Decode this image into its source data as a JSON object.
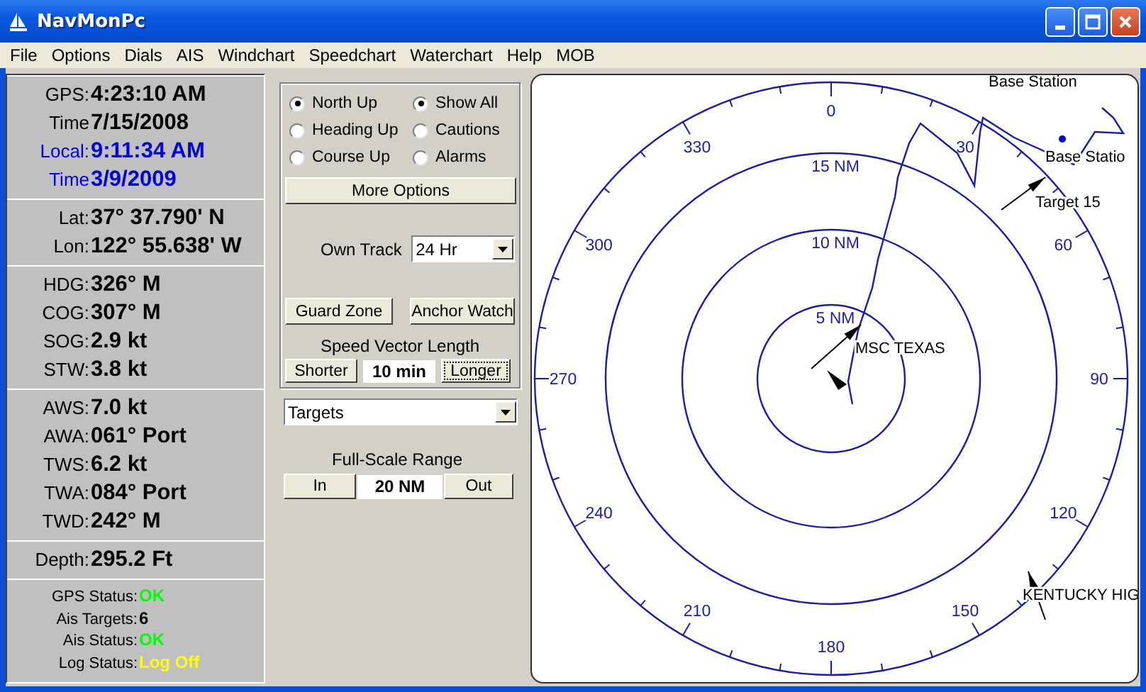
{
  "window": {
    "title": "NavMonPc"
  },
  "menu": [
    "File",
    "Options",
    "Dials",
    "AIS",
    "Windchart",
    "Speedchart",
    "Waterchart",
    "Help",
    "MOB"
  ],
  "nav_panel": {
    "groups": [
      {
        "kind": "large",
        "rows": [
          {
            "label": "GPS:",
            "value": "4:23:10 AM",
            "local": false
          },
          {
            "label": "Time",
            "value": "7/15/2008",
            "local": false
          },
          {
            "label": "Local:",
            "value": "9:11:34 AM",
            "local": true
          },
          {
            "label": "Time",
            "value": "3/9/2009",
            "local": true
          }
        ]
      },
      {
        "kind": "large",
        "rows": [
          {
            "label": "Lat:",
            "value": "37° 37.790' N",
            "local": false
          },
          {
            "label": "Lon:",
            "value": "122° 55.638' W",
            "local": false
          }
        ]
      },
      {
        "kind": "large",
        "rows": [
          {
            "label": "HDG:",
            "value": "326° M",
            "local": false
          },
          {
            "label": "COG:",
            "value": "307° M",
            "local": false
          },
          {
            "label": "SOG:",
            "value": "2.9 kt",
            "local": false
          },
          {
            "label": "STW:",
            "value": "3.8 kt",
            "local": false
          }
        ]
      },
      {
        "kind": "large",
        "rows": [
          {
            "label": "AWS:",
            "value": "7.0 kt",
            "local": false
          },
          {
            "label": "AWA:",
            "value": "061° Port",
            "local": false
          },
          {
            "label": "TWS:",
            "value": "6.2 kt",
            "local": false
          },
          {
            "label": "TWA:",
            "value": "084° Port",
            "local": false
          },
          {
            "label": "TWD:",
            "value": "242° M",
            "local": false
          }
        ]
      },
      {
        "kind": "large",
        "rows": [
          {
            "label": "Depth:",
            "value": "295.2 Ft",
            "local": false
          }
        ]
      },
      {
        "kind": "status",
        "rows": [
          {
            "label": "GPS Status:",
            "value": "OK",
            "color": "#00ff00"
          },
          {
            "label": "Ais Targets:",
            "value": "6",
            "color": "#000000"
          },
          {
            "label": "Ais Status:",
            "value": "OK",
            "color": "#00ff00"
          },
          {
            "label": "Log Status:",
            "value": "Log Off",
            "color": "#ffff00"
          }
        ]
      }
    ]
  },
  "display_controls": {
    "orientation": [
      {
        "label": "North Up",
        "selected": true
      },
      {
        "label": "Heading Up",
        "selected": false
      },
      {
        "label": "Course Up",
        "selected": false
      }
    ],
    "filter": [
      {
        "label": "Show All",
        "selected": true
      },
      {
        "label": "Cautions",
        "selected": false
      },
      {
        "label": "Alarms",
        "selected": false
      }
    ],
    "more_options": "More Options",
    "own_track": {
      "label": "Own Track",
      "value": "24 Hr"
    },
    "guard_zone": "Guard Zone",
    "anchor_watch": "Anchor Watch",
    "speed_vector": {
      "title": "Speed Vector Length",
      "shorter": "Shorter",
      "value": "10 min",
      "longer": "Longer",
      "longer_focused": true
    }
  },
  "layer_select": {
    "value": "Targets"
  },
  "range": {
    "title": "Full-Scale Range",
    "in": "In",
    "value": "20 NM",
    "out": "Out"
  },
  "radar": {
    "bearings": [
      "0",
      "30",
      "60",
      "90",
      "120",
      "150",
      "180",
      "210",
      "240",
      "270",
      "300",
      "330"
    ],
    "rings": [
      "15 NM",
      "10 NM",
      "5 NM"
    ],
    "targets": [
      {
        "kind": "label",
        "name": "Base Station"
      },
      {
        "kind": "base_station",
        "name": "Base Statio"
      },
      {
        "kind": "vessel",
        "name": "Target 15"
      },
      {
        "kind": "vessel",
        "name": "MSC TEXAS"
      },
      {
        "kind": "vessel",
        "name": "KENTUCKY HIG"
      }
    ]
  }
}
